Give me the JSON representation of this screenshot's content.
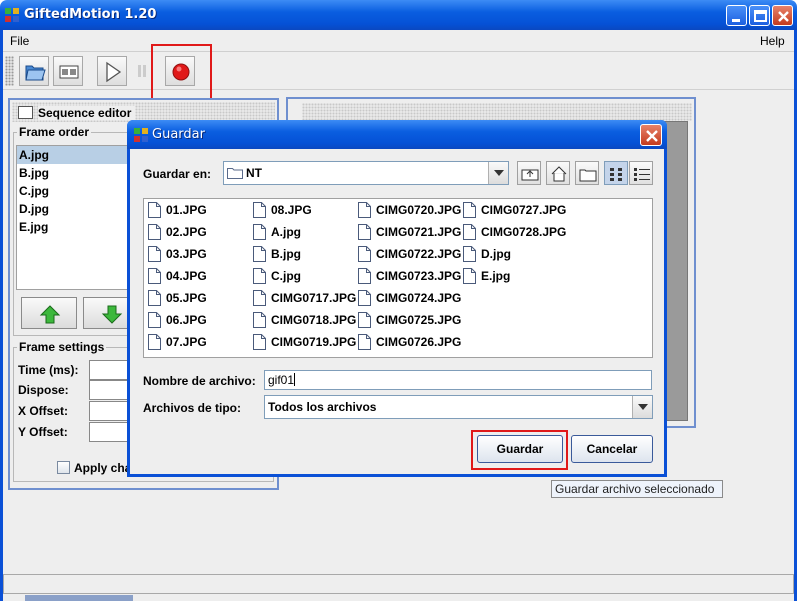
{
  "window": {
    "title": "GiftedMotion 1.20"
  },
  "menubar": {
    "file": "File",
    "help": "Help"
  },
  "toolbar": {
    "buttons": [
      "open-folder-icon",
      "frames-icon",
      "play-icon",
      "pause-icon",
      "record-icon"
    ],
    "record_color": "#e01919"
  },
  "sequence_editor": {
    "title": "Sequence editor",
    "frame_order_label": "Frame order",
    "frames": [
      "A.jpg",
      "B.jpg",
      "C.jpg",
      "D.jpg",
      "E.jpg"
    ],
    "selected_frame": "A.jpg",
    "frame_settings_label": "Frame settings",
    "time_label": "Time (ms):",
    "dispose_label": "Dispose:",
    "x_offset_label": "X Offset:",
    "y_offset_label": "Y Offset:",
    "apply_label": "Apply cha"
  },
  "dialog": {
    "title": "Guardar",
    "save_in_label": "Guardar en:",
    "save_in_value": "NT",
    "files_col1": [
      "01.JPG",
      "02.JPG",
      "03.JPG",
      "04.JPG",
      "05.JPG",
      "06.JPG",
      "07.JPG"
    ],
    "files_col2": [
      "08.JPG",
      "A.jpg",
      "B.jpg",
      "C.jpg",
      "CIMG0717.JPG",
      "CIMG0718.JPG",
      "CIMG0719.JPG"
    ],
    "files_col3": [
      "CIMG0720.JPG",
      "CIMG0721.JPG",
      "CIMG0722.JPG",
      "CIMG0723.JPG",
      "CIMG0724.JPG",
      "CIMG0725.JPG",
      "CIMG0726.JPG"
    ],
    "files_col4": [
      "CIMG0727.JPG",
      "CIMG0728.JPG",
      "D.jpg",
      "E.jpg"
    ],
    "filename_label": "Nombre de archivo:",
    "filename_value": "gif01",
    "filetype_label": "Archivos de tipo:",
    "filetype_value": "Todos los archivos",
    "save_button": "Guardar",
    "cancel_button": "Cancelar"
  },
  "tooltip": {
    "text": "Guardar archivo seleccionado"
  },
  "colors": {
    "titlebar": "#0a5ee0",
    "highlight": "#e01919",
    "selection": "#b8cfe5"
  }
}
